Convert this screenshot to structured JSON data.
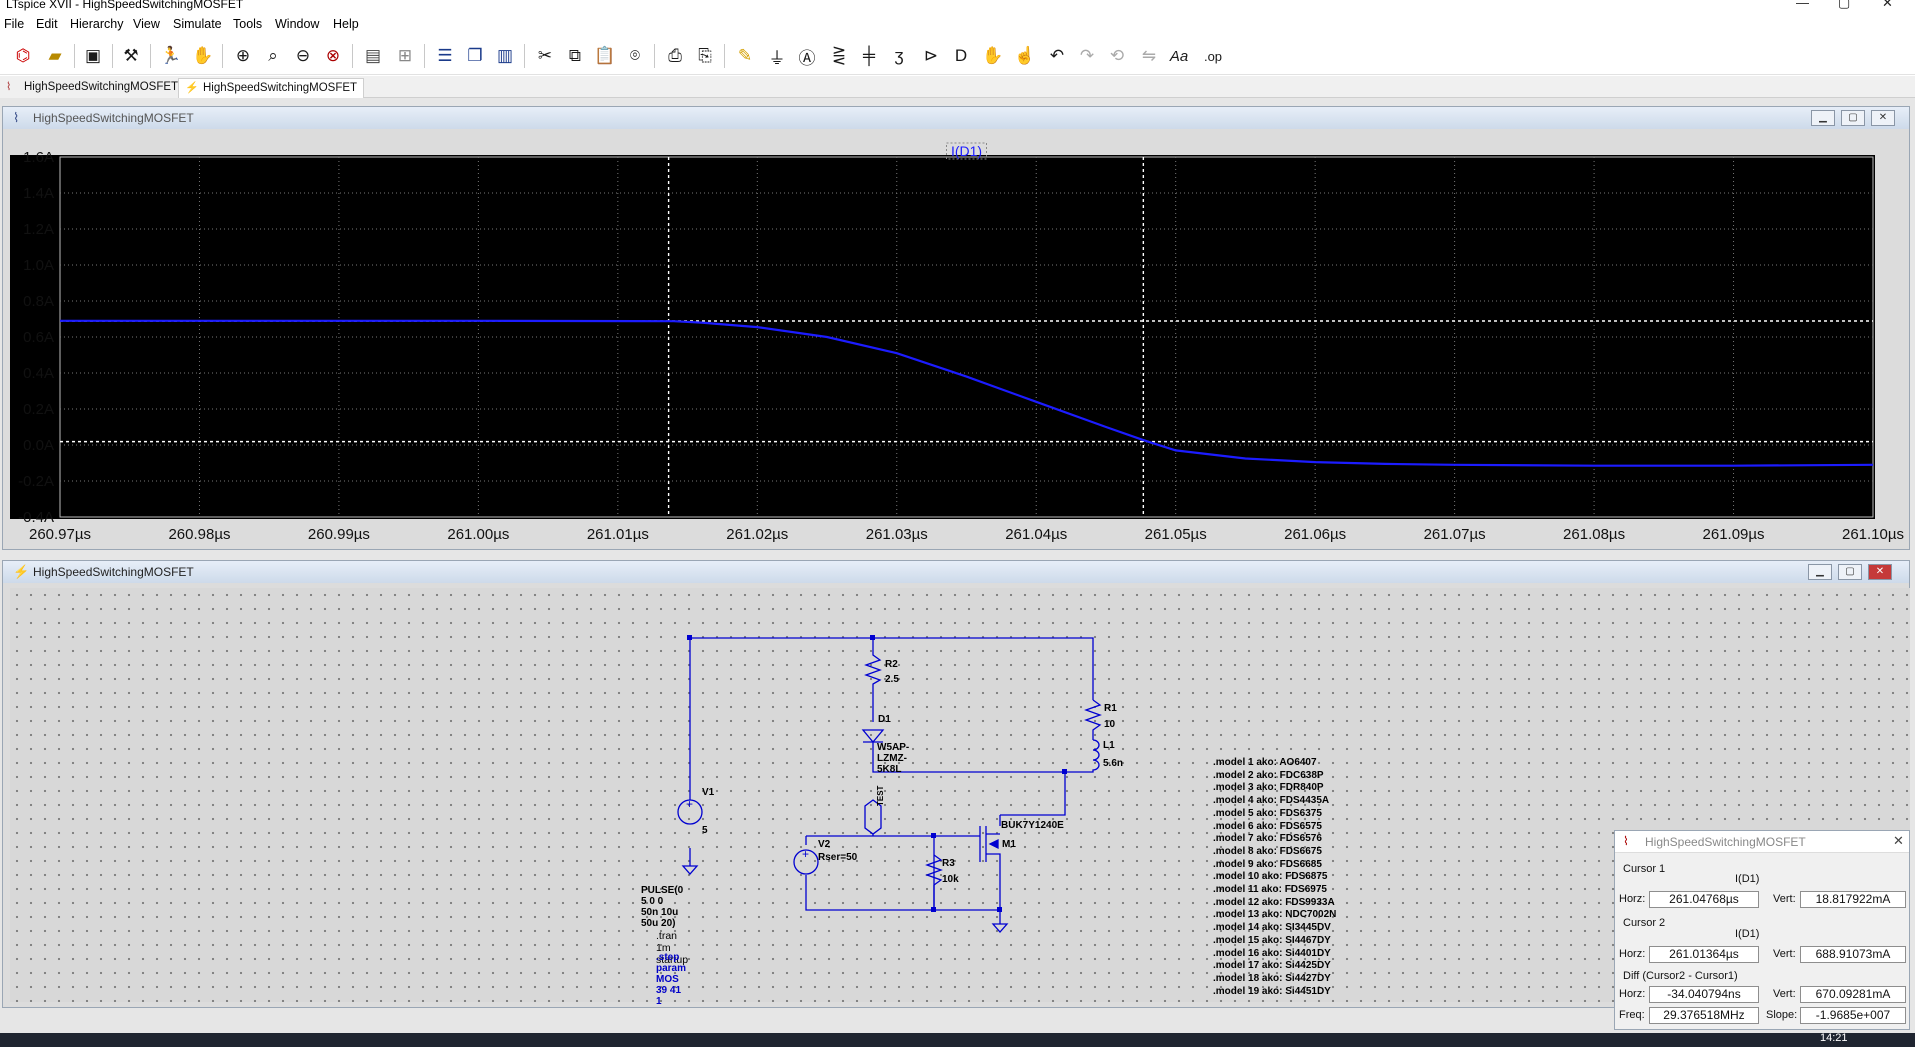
{
  "app": {
    "title": "LTspice XVII - HighSpeedSwitchingMOSFET",
    "controls": {
      "minimize": "—",
      "maximize": "▢",
      "close": "✕"
    }
  },
  "menu": [
    "File",
    "Edit",
    "Hierarchy",
    "View",
    "Simulate",
    "Tools",
    "Window",
    "Help"
  ],
  "toolbar": {
    "icons": [
      "open-schematic-icon",
      "open-folder-icon",
      "save-icon",
      "settings-icon",
      "run-icon",
      "pan-hand-icon",
      "zoom-in-icon",
      "zoom-out-icon",
      "zoom-area-icon",
      "zoom-full-icon",
      "plot-settings-icon",
      "grid-icon",
      "tile-horizontal-icon",
      "cascade-icon",
      "tile-vertical-icon",
      "cut-icon",
      "copy-icon",
      "paste-icon",
      "find-icon",
      "print-icon",
      "print-preview-icon",
      "draw-wire-icon",
      "ground-icon",
      "label-net-icon",
      "resistor-icon",
      "capacitor-icon",
      "inductor-icon",
      "diode-icon",
      "component-icon",
      "move-icon",
      "drag-icon",
      "undo-icon",
      "redo-icon",
      "rotate-icon",
      "mirror-icon",
      "text-icon",
      "spice-directive-icon"
    ],
    "text_aa": "Aa",
    "text_op": ".op"
  },
  "tabs": [
    {
      "label": "HighSpeedSwitchingMOSFET",
      "icon": "waveform-icon"
    },
    {
      "label": "HighSpeedSwitchingMOSFET",
      "icon": "schematic-icon"
    }
  ],
  "waveform_window": {
    "title": "HighSpeedSwitchingMOSFET",
    "trace_label": "I(D1)",
    "trace_color": "#1c1cff",
    "background": "#000000"
  },
  "chart_data": {
    "type": "line",
    "series": [
      {
        "name": "I(D1)",
        "x": [
          260.97,
          261.0,
          261.014,
          261.016,
          261.02,
          261.025,
          261.03,
          261.035,
          261.04,
          261.045,
          261.048,
          261.05,
          261.055,
          261.06,
          261.065,
          261.07,
          261.08,
          261.09,
          261.1
        ],
        "y": [
          0.69,
          0.69,
          0.688,
          0.68,
          0.655,
          0.6,
          0.51,
          0.38,
          0.24,
          0.1,
          0.019,
          -0.03,
          -0.075,
          -0.095,
          -0.105,
          -0.11,
          -0.115,
          -0.115,
          -0.11
        ]
      }
    ],
    "xlim": [
      260.97,
      261.1
    ],
    "ylim": [
      -0.4,
      1.6
    ],
    "x_ticks": [
      "260.97µs",
      "260.98µs",
      "260.99µs",
      "261.00µs",
      "261.01µs",
      "261.02µs",
      "261.03µs",
      "261.04µs",
      "261.05µs",
      "261.06µs",
      "261.07µs",
      "261.08µs",
      "261.09µs",
      "261.10µs"
    ],
    "y_ticks": [
      "1.6A",
      "1.4A",
      "1.2A",
      "1.0A",
      "0.8A",
      "0.6A",
      "0.4A",
      "0.2A",
      "0.0A",
      "-0.2A",
      "-0.4A"
    ],
    "grid": true,
    "cursors": [
      {
        "x": 261.04768,
        "y": 0.018817922
      },
      {
        "x": 261.01364,
        "y": 0.68891073
      }
    ]
  },
  "schematic_window": {
    "title": "HighSpeedSwitchingMOSFET",
    "wire_color": "#0000d0",
    "labels": {
      "r2_name": "R2",
      "r2_val": "2.5",
      "d1_name": "D1",
      "d1_val": "W5AP-LZMZ-5K8L",
      "r1_name": "R1",
      "r1_val": "10",
      "l1_name": "L1",
      "l1_val": "5.6n",
      "v1_name": "V1",
      "v1_val": "5",
      "v2_name": "V2",
      "v2_val": "Rser=50",
      "v2_pulse": "PULSE(0 5 0 0 50n 10u 50u 20)",
      "r3_name": "R3",
      "r3_val": "10k",
      "m1_name": "M1",
      "m1_val": "BUK7Y1240E",
      "test_label": "TEST",
      "tran": ".tran 1m startup",
      "step": ".step param MOS 39 41 1"
    },
    "models": [
      ".model 1  ako: AO6407",
      ".model 2  ako: FDC638P",
      ".model 3  ako: FDR840P",
      ".model 4  ako: FDS4435A",
      ".model 5  ako: FDS6375",
      ".model 6  ako: FDS6575",
      ".model 7  ako: FDS6576",
      ".model 8  ako: FDS6675",
      ".model 9  ako: FDS6685",
      ".model 10 ako: FDS6875",
      ".model 11 ako: FDS6975",
      ".model 12 ako: FDS9933A",
      ".model 13 ako: NDC7002N",
      ".model 14 ako: SI3445DV",
      ".model 15 ako: SI4467DY",
      ".model 16 ako: Si4401DY",
      ".model 17 ako: Si4425DY",
      ".model 18 ako: Si4427DY",
      ".model 19 ako: Si4451DY"
    ]
  },
  "cursor_panel": {
    "title": "HighSpeedSwitchingMOSFET",
    "cursor1_label": "Cursor 1",
    "cursor1_trace": "I(D1)",
    "cursor1_horz": "261.04768µs",
    "cursor1_vert": "18.817922mA",
    "cursor2_label": "Cursor 2",
    "cursor2_trace": "I(D1)",
    "cursor2_horz": "261.01364µs",
    "cursor2_vert": "688.91073mA",
    "diff_label": "Diff (Cursor2 - Cursor1)",
    "diff_horz": "-34.040794ns",
    "diff_vert": "670.09281mA",
    "freq": "29.376518MHz",
    "slope": "-1.9685e+007",
    "horz_label": "Horz:",
    "vert_label": "Vert:",
    "freq_label": "Freq:",
    "slope_label": "Slope:"
  },
  "taskbar": {
    "clock": "14:21"
  }
}
